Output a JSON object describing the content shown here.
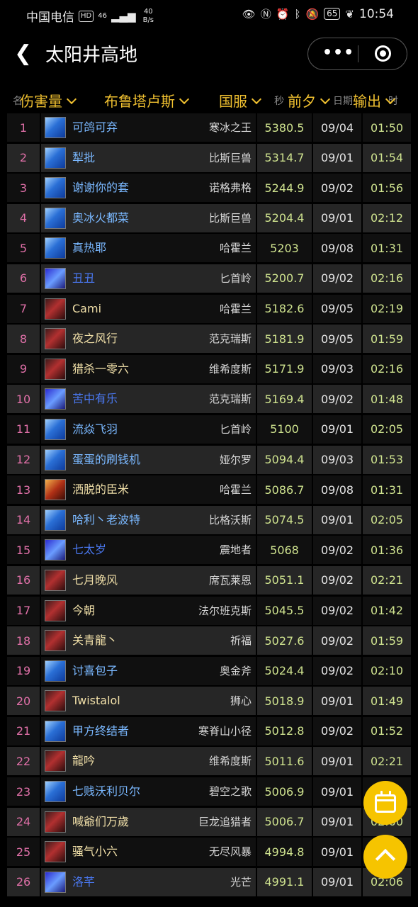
{
  "status_bar": {
    "carrier": "中国电信",
    "hd": "HD",
    "network": "46",
    "speed_value": "40",
    "speed_unit": "B/s",
    "battery": "65",
    "time": "10:54"
  },
  "nav": {
    "title": "太阳井高地",
    "back_icon": "chevron-left-icon",
    "more_label": "•••"
  },
  "filters": {
    "metric": "伤害量",
    "class": "布鲁塔卢斯",
    "region": "国服",
    "boss": "前夕",
    "role": "输出"
  },
  "hidden_headers": {
    "rank": "名",
    "score": "秒",
    "date": "日期",
    "time": "时"
  },
  "colors": {
    "accent": "#f6c400",
    "filter_text": "#f0c030",
    "rank": "#e070a8",
    "score": "#cfe38f"
  },
  "rows": [
    {
      "rank": "1",
      "name": "可鸽可弃",
      "realm": "寒冰之王",
      "score": "5380.5",
      "date": "09/04",
      "time": "01:50",
      "spec": "frost",
      "cls": "mage"
    },
    {
      "rank": "2",
      "name": "犁批",
      "realm": "比斯巨兽",
      "score": "5314.7",
      "date": "09/01",
      "time": "01:54",
      "spec": "frost",
      "cls": "mage"
    },
    {
      "rank": "3",
      "name": "谢谢你的套",
      "realm": "诺格弗格",
      "score": "5244.9",
      "date": "09/02",
      "time": "01:56",
      "spec": "frost",
      "cls": "mage"
    },
    {
      "rank": "4",
      "name": "奥冰火都菜",
      "realm": "比斯巨兽",
      "score": "5204.4",
      "date": "09/01",
      "time": "02:12",
      "spec": "frost",
      "cls": "mage"
    },
    {
      "rank": "5",
      "name": "真热耶",
      "realm": "哈霍兰",
      "score": "5203",
      "date": "09/08",
      "time": "01:31",
      "spec": "frost",
      "cls": "mage"
    },
    {
      "rank": "6",
      "name": "丑丑",
      "realm": "匕首岭",
      "score": "5200.7",
      "date": "09/02",
      "time": "02:16",
      "spec": "arcane",
      "cls": "shaman"
    },
    {
      "rank": "7",
      "name": "Cami",
      "realm": "哈霍兰",
      "score": "5182.6",
      "date": "09/05",
      "time": "02:19",
      "spec": "blood",
      "cls": "dk"
    },
    {
      "rank": "8",
      "name": "夜之风行",
      "realm": "范克瑞斯",
      "score": "5181.9",
      "date": "09/05",
      "time": "01:59",
      "spec": "blood",
      "cls": "dk"
    },
    {
      "rank": "9",
      "name": "猎杀一零六",
      "realm": "维希度斯",
      "score": "5171.9",
      "date": "09/03",
      "time": "02:16",
      "spec": "blood",
      "cls": "dk"
    },
    {
      "rank": "10",
      "name": "苦中有乐",
      "realm": "范克瑞斯",
      "score": "5169.4",
      "date": "09/02",
      "time": "01:48",
      "spec": "arcane",
      "cls": "shaman"
    },
    {
      "rank": "11",
      "name": "流焱飞羽",
      "realm": "匕首岭",
      "score": "5100",
      "date": "09/01",
      "time": "02:05",
      "spec": "frost",
      "cls": "mage"
    },
    {
      "rank": "12",
      "name": "蛋蛋的刷钱机",
      "realm": "娅尔罗",
      "score": "5094.4",
      "date": "09/03",
      "time": "01:53",
      "spec": "frost",
      "cls": "mage"
    },
    {
      "rank": "13",
      "name": "洒脱的臣米",
      "realm": "哈霍兰",
      "score": "5086.7",
      "date": "09/08",
      "time": "01:31",
      "spec": "fire",
      "cls": "warlock"
    },
    {
      "rank": "14",
      "name": "哈利丶老波特",
      "realm": "比格沃斯",
      "score": "5074.5",
      "date": "09/01",
      "time": "02:05",
      "spec": "frost",
      "cls": "mage"
    },
    {
      "rank": "15",
      "name": "七太岁",
      "realm": "震地者",
      "score": "5068",
      "date": "09/02",
      "time": "01:36",
      "spec": "arcane",
      "cls": "shaman"
    },
    {
      "rank": "16",
      "name": "七月晚风",
      "realm": "席瓦莱恩",
      "score": "5051.1",
      "date": "09/02",
      "time": "02:21",
      "spec": "blood",
      "cls": "dk"
    },
    {
      "rank": "17",
      "name": "今朝",
      "realm": "法尔班克斯",
      "score": "5045.5",
      "date": "09/02",
      "time": "01:42",
      "spec": "blood",
      "cls": "dk"
    },
    {
      "rank": "18",
      "name": "关青龍丶",
      "realm": "祈福",
      "score": "5027.6",
      "date": "09/02",
      "time": "01:59",
      "spec": "blood",
      "cls": "dk"
    },
    {
      "rank": "19",
      "name": "讨喜包子",
      "realm": "奥金斧",
      "score": "5024.4",
      "date": "09/02",
      "time": "02:10",
      "spec": "frost",
      "cls": "mage"
    },
    {
      "rank": "20",
      "name": "Twistalol",
      "realm": "狮心",
      "score": "5018.9",
      "date": "09/01",
      "time": "01:49",
      "spec": "blood",
      "cls": "dk"
    },
    {
      "rank": "21",
      "name": "甲方终结者",
      "realm": "寒脊山小径",
      "score": "5012.8",
      "date": "09/02",
      "time": "01:52",
      "spec": "frost",
      "cls": "mage"
    },
    {
      "rank": "22",
      "name": "龍吟",
      "realm": "维希度斯",
      "score": "5011.6",
      "date": "09/01",
      "time": "02:21",
      "spec": "blood",
      "cls": "dk"
    },
    {
      "rank": "23",
      "name": "七贱沃利贝尔",
      "realm": "碧空之歌",
      "score": "5006.9",
      "date": "09/01",
      "time": "",
      "spec": "frost",
      "cls": "mage"
    },
    {
      "rank": "24",
      "name": "喊爺们万歲",
      "realm": "巨龙追猎者",
      "score": "5006.7",
      "date": "09/01",
      "time": "02:00",
      "spec": "blood",
      "cls": "dk"
    },
    {
      "rank": "25",
      "name": "骚气小六",
      "realm": "无尽风暴",
      "score": "4994.8",
      "date": "09/01",
      "time": "",
      "spec": "blood",
      "cls": "dk"
    },
    {
      "rank": "26",
      "name": "洛芊",
      "realm": "光芒",
      "score": "4991.1",
      "date": "09/01",
      "time": "02:06",
      "spec": "arcane",
      "cls": "shaman"
    }
  ]
}
